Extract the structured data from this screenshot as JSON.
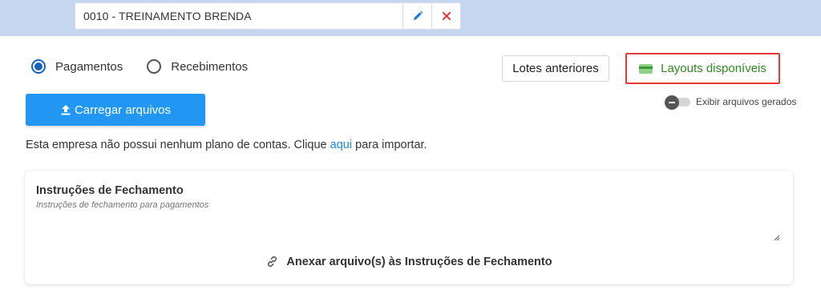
{
  "company": {
    "name": "0010 - TREINAMENTO BRENDA",
    "edit_icon": "pencil-icon",
    "clear_icon": "close-icon"
  },
  "type_selector": {
    "options": [
      {
        "label": "Pagamentos",
        "checked": true
      },
      {
        "label": "Recebimentos",
        "checked": false
      }
    ]
  },
  "actions": {
    "previous_batches": "Lotes anteriores",
    "available_layouts": "Layouts disponíveis",
    "upload": "Carregar arquivos",
    "show_generated_files": "Exibir arquivos gerados",
    "show_generated_files_on": false
  },
  "info": {
    "prefix": "Esta empresa não possui nenhum plano de contas. Clique",
    "link": "aqui",
    "suffix": "para importar."
  },
  "closing_instructions": {
    "title": "Instruções de Fechamento",
    "placeholder": "Instruções de fechamento para pagamentos",
    "value": "",
    "attach_label": "Anexar arquivo(s) às Instruções de Fechamento"
  },
  "colors": {
    "topbar": "#c5d6f1",
    "primary": "#2196f3",
    "radio_checked": "#1565c0",
    "layouts_border": "#e53935",
    "layouts_text": "#2e8b1e",
    "link": "#1e88e5",
    "danger_icon": "#e53935"
  }
}
